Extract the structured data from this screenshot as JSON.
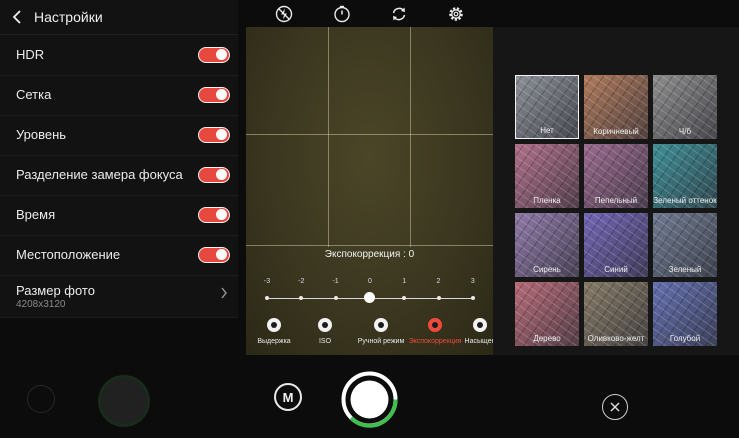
{
  "settings": {
    "title": "Настройки",
    "items": [
      {
        "label": "HDR",
        "on": true
      },
      {
        "label": "Сетка",
        "on": true
      },
      {
        "label": "Уровень",
        "on": true
      },
      {
        "label": "Разделение замера фокуса",
        "on": true
      },
      {
        "label": "Время",
        "on": true
      },
      {
        "label": "Местоположение",
        "on": true
      }
    ],
    "photo_size": {
      "label": "Размер фото",
      "value": "4208x3120"
    }
  },
  "top_icons": [
    "flash-off-icon",
    "timer-icon",
    "switch-camera-icon",
    "settings-gear-icon"
  ],
  "exposure": {
    "title": "Экспокоррекция : 0",
    "ticks": [
      "-3",
      "-2",
      "-1",
      "0",
      "1",
      "2",
      "3"
    ],
    "value": 0
  },
  "modes": [
    {
      "label": "Выдержка",
      "icon": "shutter-speed-icon",
      "active": false
    },
    {
      "label": "ISO",
      "icon": "iso-icon",
      "active": false
    },
    {
      "label": "Ручной режим",
      "icon": "manual-mode-icon",
      "active": false
    },
    {
      "label": "Экспокоррекция",
      "icon": "exposure-icon",
      "active": true
    },
    {
      "label": "Насыщен",
      "icon": "saturation-icon",
      "active": false
    }
  ],
  "filters": [
    {
      "label": "Нет",
      "color": "#8a8f96",
      "selected": true
    },
    {
      "label": "Коричневый",
      "color": "#b07a5c",
      "selected": false
    },
    {
      "label": "Ч/б",
      "color": "#8d8d8d",
      "selected": false
    },
    {
      "label": "Пленка",
      "color": "#b0708a",
      "selected": false
    },
    {
      "label": "Пепельный",
      "color": "#9a6a8e",
      "selected": false
    },
    {
      "label": "Зеленый оттенок",
      "color": "#3f8e96",
      "selected": false
    },
    {
      "label": "Сирень",
      "color": "#8f7aa8",
      "selected": false
    },
    {
      "label": "Синий",
      "color": "#7466b6",
      "selected": false
    },
    {
      "label": "Зеленый",
      "color": "#6f7a90",
      "selected": false
    },
    {
      "label": "Дерево",
      "color": "#b66b78",
      "selected": false
    },
    {
      "label": "Оливково-желт",
      "color": "#857a66",
      "selected": false
    },
    {
      "label": "Голубой",
      "color": "#6470b0",
      "selected": false
    }
  ],
  "bottom": {
    "mode_button_label": "M"
  },
  "colors": {
    "accent": "#ef4a3c",
    "shutter_ring": "#3fbf4e"
  }
}
